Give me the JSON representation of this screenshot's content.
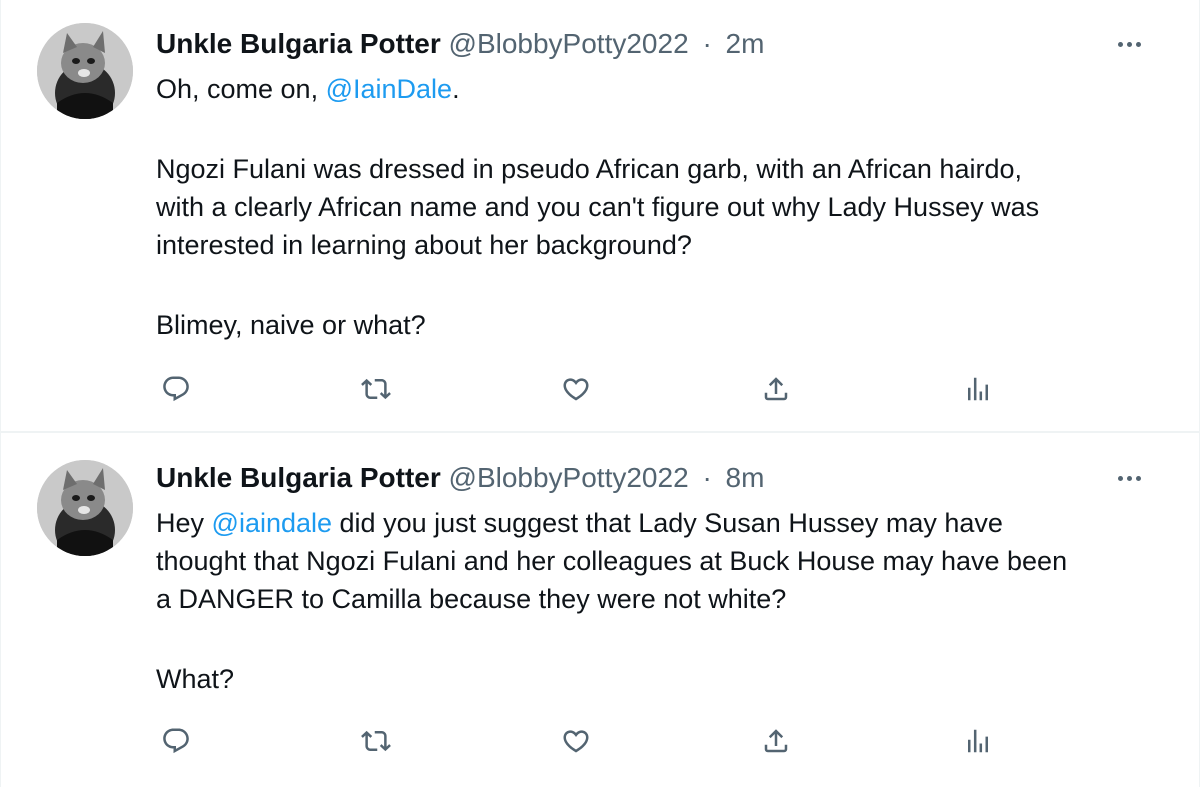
{
  "colors": {
    "text": "#0f1419",
    "secondary": "#536471",
    "mention": "#1d9bf0",
    "divider": "#eff3f4"
  },
  "icons": {
    "avatar": "cat-photo-avatar",
    "more": "more-dots-icon",
    "reply": "reply-icon",
    "retweet": "retweet-icon",
    "like": "heart-icon",
    "share": "share-icon",
    "views": "analytics-icon"
  },
  "tweets": [
    {
      "author": {
        "name": "Unkle Bulgaria Potter",
        "handle": "@BlobbyPotty2022",
        "separator": "·",
        "time": "2m"
      },
      "body": {
        "p1_prefix": "Oh, come on, ",
        "p1_mention": "@IainDale",
        "p1_suffix": ".",
        "p2_line1": "Ngozi Fulani was dressed in pseudo African garb, with an African hairdo,",
        "p2_line2": "with a clearly African name and you can't figure out why Lady Hussey was",
        "p2_line3": "interested in learning about her background?",
        "p3": "Blimey, naive or what?"
      }
    },
    {
      "author": {
        "name": "Unkle Bulgaria Potter",
        "handle": "@BlobbyPotty2022",
        "separator": "·",
        "time": "8m"
      },
      "body": {
        "p1_prefix": "Hey ",
        "p1_mention": "@iaindale",
        "p1_line1_suffix": " did you just suggest that Lady Susan Hussey may have",
        "p1_line2": "thought that Ngozi Fulani and her colleagues at Buck House may have been",
        "p1_line3": "a DANGER to Camilla because they were not white?",
        "p2": "What?"
      }
    }
  ]
}
